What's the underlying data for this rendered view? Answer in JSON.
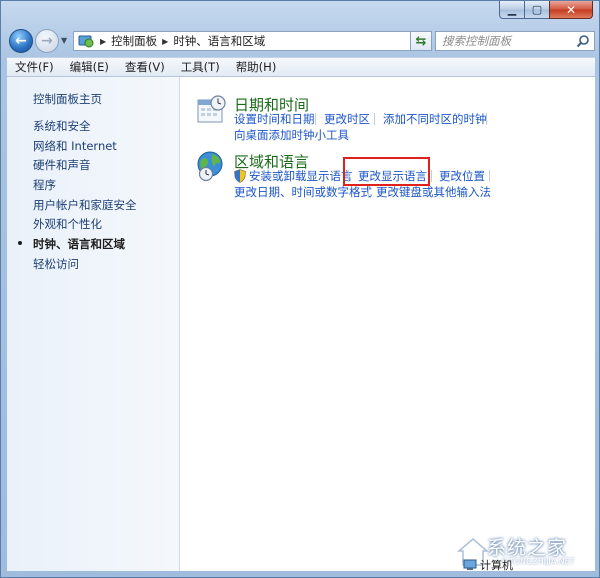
{
  "address_bar": {
    "crumbs": [
      "控制面板",
      "时钟、语言和区域"
    ],
    "search_placeholder": "搜索控制面板"
  },
  "menu": [
    "文件(F)",
    "编辑(E)",
    "查看(V)",
    "工具(T)",
    "帮助(H)"
  ],
  "sidebar": {
    "items": [
      {
        "label": "控制面板主页",
        "active": false
      },
      {
        "label": "系统和安全",
        "active": false
      },
      {
        "label": "网络和 Internet",
        "active": false
      },
      {
        "label": "硬件和声音",
        "active": false
      },
      {
        "label": "程序",
        "active": false
      },
      {
        "label": "用户帐户和家庭安全",
        "active": false
      },
      {
        "label": "外观和个性化",
        "active": false
      },
      {
        "label": "时钟、语言和区域",
        "active": true
      },
      {
        "label": "轻松访问",
        "active": false
      }
    ]
  },
  "categories": [
    {
      "title": "日期和时间",
      "icon": "calendar-clock-icon",
      "links": [
        "设置时间和日期",
        "更改时区",
        "添加不同时区的时钟",
        "向桌面添加时钟小工具"
      ]
    },
    {
      "title": "区域和语言",
      "icon": "globe-clock-icon",
      "links": [
        "安装或卸载显示语言",
        "更改显示语言",
        "更改位置",
        "更改日期、时间或数字格式",
        "更改键盘或其他输入法"
      ]
    }
  ],
  "status": {
    "label": "计算机"
  },
  "watermark": {
    "text": "系统之家",
    "url": "XITONGZHIJIA.NET"
  },
  "colors": {
    "link": "#1c56c8",
    "category_title": "#1a6b19",
    "highlight_box": "#e0201b",
    "sidebar_link": "#1c3f76"
  }
}
